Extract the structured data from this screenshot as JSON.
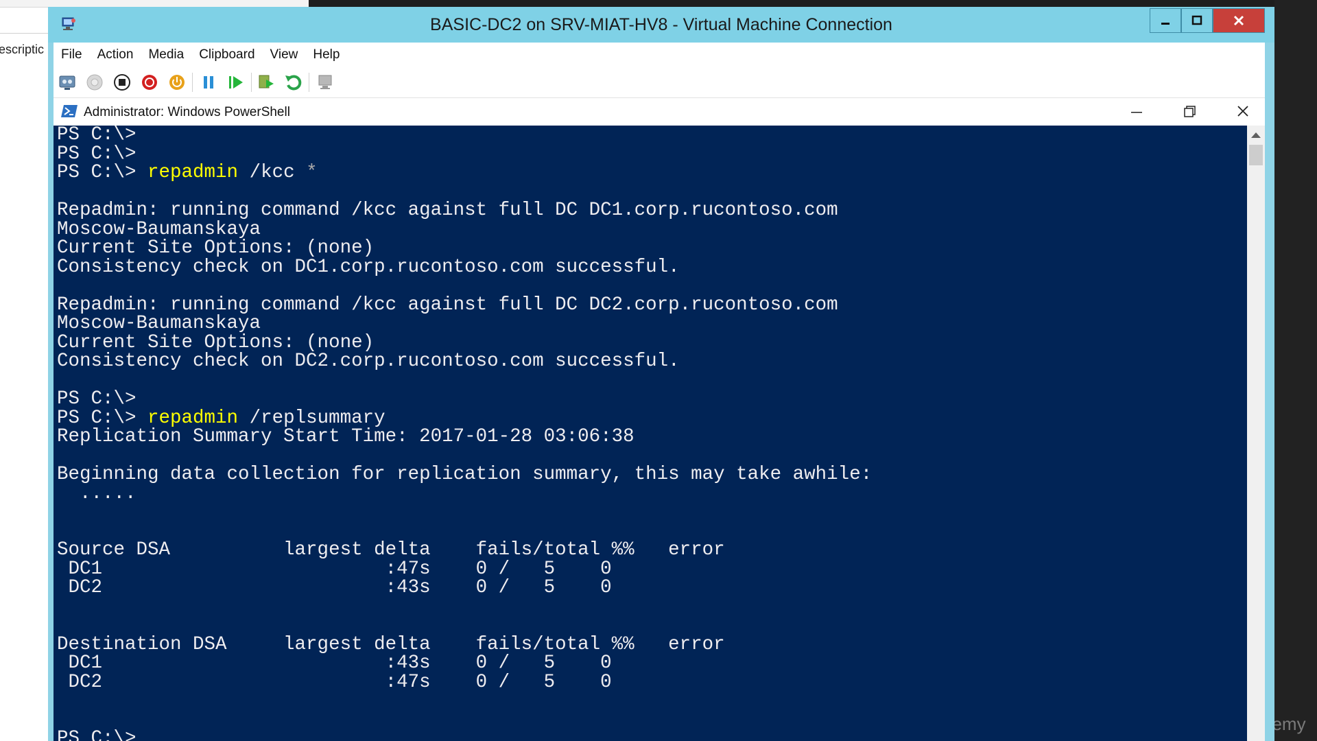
{
  "background": {
    "partial_text": "escriptic",
    "watermark": "demy"
  },
  "vm_window": {
    "title": "BASIC-DC2 on SRV-MIAT-HV8 - Virtual Machine Connection",
    "menu": [
      "File",
      "Action",
      "Media",
      "Clipboard",
      "View",
      "Help"
    ]
  },
  "powershell": {
    "title": "Administrator: Windows PowerShell",
    "lines": [
      {
        "text": "PS C:\\>"
      },
      {
        "text": "PS C:\\>"
      },
      {
        "text": "PS C:\\> ",
        "cmd": "repadmin",
        "rest": " /kcc ",
        "dim": "*"
      },
      {
        "text": ""
      },
      {
        "text": "Repadmin: running command /kcc against full DC DC1.corp.rucontoso.com"
      },
      {
        "text": "Moscow-Baumanskaya"
      },
      {
        "text": "Current Site Options: (none)"
      },
      {
        "text": "Consistency check on DC1.corp.rucontoso.com successful."
      },
      {
        "text": ""
      },
      {
        "text": "Repadmin: running command /kcc against full DC DC2.corp.rucontoso.com"
      },
      {
        "text": "Moscow-Baumanskaya"
      },
      {
        "text": "Current Site Options: (none)"
      },
      {
        "text": "Consistency check on DC2.corp.rucontoso.com successful."
      },
      {
        "text": ""
      },
      {
        "text": "PS C:\\>"
      },
      {
        "text": "PS C:\\> ",
        "cmd": "repadmin",
        "rest": " /replsummary"
      },
      {
        "text": "Replication Summary Start Time: 2017-01-28 03:06:38"
      },
      {
        "text": ""
      },
      {
        "text": "Beginning data collection for replication summary, this may take awhile:"
      },
      {
        "text": "  ....."
      },
      {
        "text": ""
      },
      {
        "text": ""
      },
      {
        "text": "Source DSA          largest delta    fails/total %%   error"
      },
      {
        "text": " DC1                         :47s    0 /   5    0"
      },
      {
        "text": " DC2                         :43s    0 /   5    0"
      },
      {
        "text": ""
      },
      {
        "text": ""
      },
      {
        "text": "Destination DSA     largest delta    fails/total %%   error"
      },
      {
        "text": " DC1                         :43s    0 /   5    0"
      },
      {
        "text": " DC2                         :47s    0 /   5    0"
      },
      {
        "text": ""
      },
      {
        "text": ""
      },
      {
        "text": "PS C:\\>"
      }
    ]
  },
  "colors": {
    "console_bg": "#012456",
    "console_text": "#eeedf0",
    "command_text": "#ffff00",
    "titlebar": "#7fd1e6",
    "close_button": "#c7403a"
  }
}
